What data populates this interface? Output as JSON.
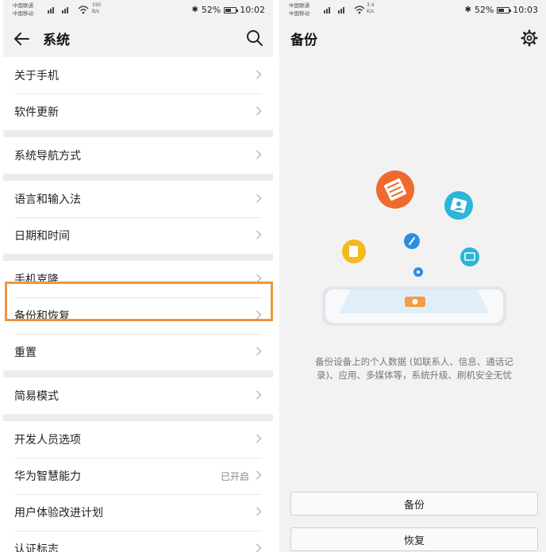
{
  "left": {
    "status": {
      "carrier1": "中国联通",
      "carrier2": "中国移动",
      "net_speed": "195",
      "net_unit": "B/s",
      "battery": "52%",
      "time": "10:02"
    },
    "title": "系统",
    "groups": [
      [
        {
          "label": "关于手机"
        },
        {
          "label": "软件更新"
        }
      ],
      [
        {
          "label": "系统导航方式"
        }
      ],
      [
        {
          "label": "语言和输入法"
        },
        {
          "label": "日期和时间"
        }
      ],
      [
        {
          "label": "手机克隆"
        },
        {
          "label": "备份和恢复"
        },
        {
          "label": "重置"
        }
      ],
      [
        {
          "label": "简易模式"
        }
      ],
      [
        {
          "label": "开发人员选项"
        },
        {
          "label": "华为智慧能力",
          "value": "已开启"
        },
        {
          "label": "用户体验改进计划"
        },
        {
          "label": "认证标志"
        }
      ]
    ]
  },
  "right": {
    "status": {
      "carrier1": "中国联通",
      "carrier2": "中国移动",
      "net_speed": "3.4",
      "net_unit": "K/s",
      "battery": "52%",
      "time": "10:03"
    },
    "title": "备份",
    "description": "备份设备上的个人数据 (如联系人、信息、通话记录)、应用、多媒体等，系统升级、刷机安全无忧",
    "backup_button": "备份",
    "restore_button": "恢复"
  },
  "colors": {
    "highlight": "#f0953a",
    "orange_icon": "#ef6a2e",
    "cyan_icon": "#29b6d8",
    "yellow_icon": "#f6b91a",
    "blue_icon": "#2f8de0",
    "page_bg": "#f2f2f2"
  }
}
